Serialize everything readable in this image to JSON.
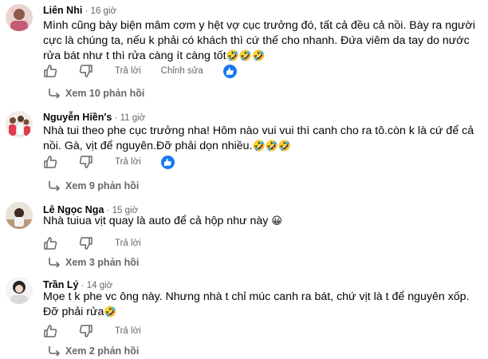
{
  "comments": [
    {
      "author": "Liên Nhi",
      "time": "16 giờ",
      "text": "Mình cũng bày biện mâm cơm y hệt vợ cục trưởng đó, tất cả đều cả nồi. Bày ra người cực là chúng ta, nếu k phải có khách thì cứ thế cho nhanh. Đứa viêm da tay do nước rửa bát như t thì rửa càng ít càng tốt",
      "emoji": "🤣🤣🤣",
      "actions": {
        "reply": "Trả lời",
        "edit": "Chỉnh sửa"
      },
      "replies": "Xem 10 phản hồi"
    },
    {
      "author": "Nguyễn Hiền's",
      "time": "11 giờ",
      "text": "Nhà tui theo phe cục trưởng nha! Hôm nào vui vui thì canh cho ra tô.còn k là cứ để cả nồi. Gà, vịt để nguyên.Đỡ phải dọn nhiều.",
      "emoji": "🤣🤣🤣",
      "actions": {
        "reply": "Trả lời"
      },
      "replies": "Xem 9 phản hồi"
    },
    {
      "author": "Lê Ngọc Nga",
      "time": "15 giờ",
      "text": "Nhà tuiua vịt quay là auto để cả hộp như này",
      "emoji": "😀",
      "actions": {
        "reply": "Trả lời"
      },
      "replies": "Xem 3 phản hồi"
    },
    {
      "author": "Trần Lý",
      "time": "14 giờ",
      "text": "Mọe t k phe vc ông này. Nhưng nhà t chỉ múc canh ra bát, chứ vịt là t để nguyên xốp. Đỡ phải rửa",
      "emoji": "🤣",
      "actions": {
        "reply": "Trả lời"
      },
      "replies": "Xem 2 phản hồi"
    }
  ],
  "colors": {
    "like_blue": "#1877f2",
    "meta_gray": "#65676b",
    "text": "#050505"
  },
  "icons": [
    "like-icon",
    "dislike-icon",
    "reaction-like-icon",
    "reply-arrow-icon"
  ]
}
